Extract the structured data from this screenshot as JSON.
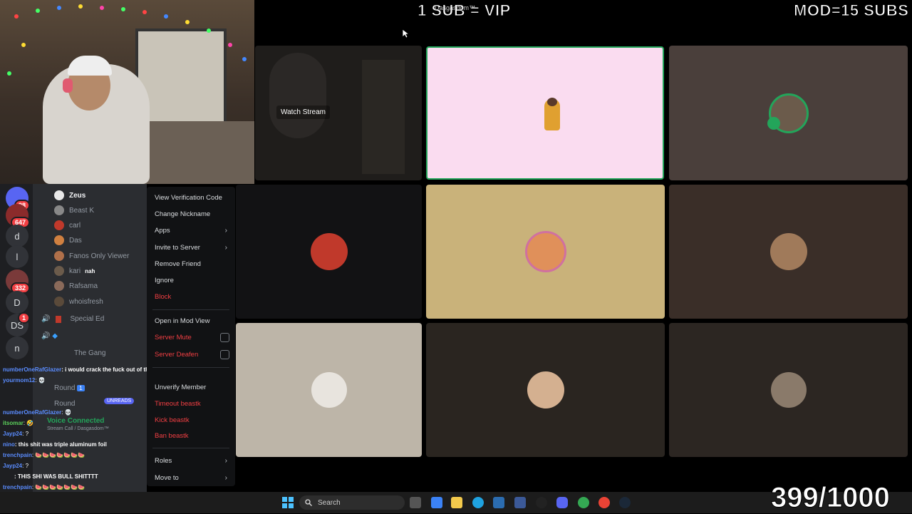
{
  "overlay": {
    "sub_vip": "1 SUB = VIP",
    "mod_subs": "MOD=15 SUBS",
    "counter": "399/1000",
    "top_header": "Dasgasdom™"
  },
  "stage": {
    "watch_stream": "Watch Stream"
  },
  "servers": [
    {
      "label": "",
      "badge": "98"
    },
    {
      "label": "",
      "badge": "647"
    },
    {
      "label": "d",
      "badge": ""
    },
    {
      "label": "l",
      "badge": ""
    },
    {
      "label": "",
      "badge": "332"
    },
    {
      "label": "D",
      "badge": ""
    },
    {
      "label": "DS",
      "badge": "1"
    },
    {
      "label": "n",
      "badge": ""
    }
  ],
  "members": [
    {
      "name": "Zeus",
      "color": "#e8e8e8"
    },
    {
      "name": "Beast K",
      "color": "#888888"
    },
    {
      "name": "carl",
      "color": "#c0392b"
    },
    {
      "name": "Das",
      "color": "#d08040"
    },
    {
      "name": "Fanos Only Viewer",
      "color": "#b0704a"
    },
    {
      "name": "kari",
      "color": "#6b5b4b"
    },
    {
      "name": "Rafsama",
      "color": "#8a6a5a"
    },
    {
      "name": "whoisfresh",
      "color": "#5a4a3a"
    }
  ],
  "member_extra": "nah",
  "channels": {
    "special_ed": "Special Ed",
    "the_gang": "The Gang",
    "round1": "Round",
    "round_badge": "1",
    "round2": "Round",
    "unreads": "UNREADS",
    "connected": "Voice Connected",
    "connected_sub": "Stream Call / Dasgasdom™"
  },
  "context_menu": {
    "view_verification_code": "View Verification Code",
    "change_nickname": "Change Nickname",
    "apps": "Apps",
    "invite_to_server": "Invite to Server",
    "remove_friend": "Remove Friend",
    "ignore": "Ignore",
    "block": "Block",
    "open_in_mod_view": "Open in Mod View",
    "server_mute": "Server Mute",
    "server_deafen": "Server Deafen",
    "unverify_member": "Unverify Member",
    "timeout": "Timeout beastk",
    "kick": "Kick beastk",
    "ban": "Ban beastk",
    "roles": "Roles",
    "move_to": "Move to"
  },
  "chat": [
    {
      "user": "numberOneRafGlazer",
      "text": ": i would crack the fuck out of that shibuya girl"
    },
    {
      "user": "yourmom12",
      "text": ": 💀"
    },
    {
      "user": "numberOneRafGlazer",
      "text": ": 💀"
    },
    {
      "user": "itsomar",
      "text": ": 🤣"
    },
    {
      "user": "Jayp24",
      "text": ": ?"
    },
    {
      "user": "nino",
      "text": ": this shit was triple aluminum foil"
    },
    {
      "user": "trenchpain",
      "text": ": 🍉🍉🍉🍉🍉🍉🍉"
    },
    {
      "user": "Jayp24",
      "text": ": ?"
    },
    {
      "user": "",
      "text": ": THIS SHI WAS BULL SHITTTT"
    },
    {
      "user": "trenchpain",
      "text": ": 🍉🍉🍉🍉🍉🍉🍉"
    }
  ],
  "taskbar": {
    "search": "Search"
  }
}
